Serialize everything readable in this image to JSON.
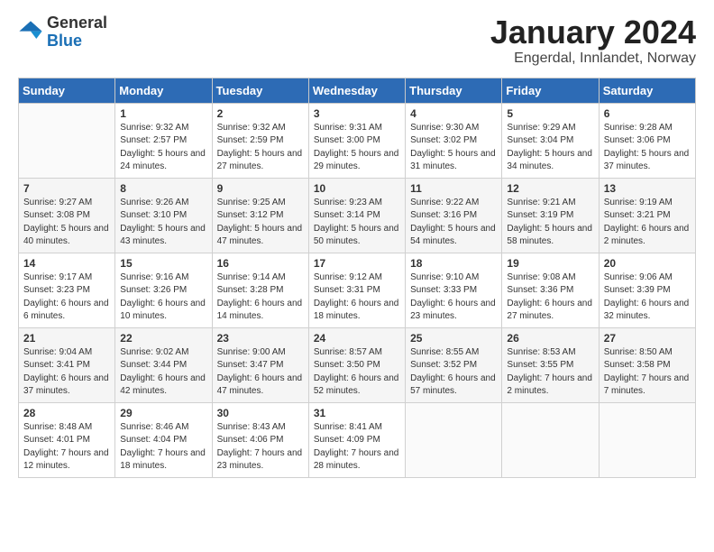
{
  "header": {
    "logo_general": "General",
    "logo_blue": "Blue",
    "month_title": "January 2024",
    "location": "Engerdal, Innlandet, Norway"
  },
  "weekdays": [
    "Sunday",
    "Monday",
    "Tuesday",
    "Wednesday",
    "Thursday",
    "Friday",
    "Saturday"
  ],
  "weeks": [
    [
      {
        "day": "",
        "sunrise": "",
        "sunset": "",
        "daylight": ""
      },
      {
        "day": "1",
        "sunrise": "9:32 AM",
        "sunset": "2:57 PM",
        "daylight": "5 hours and 24 minutes."
      },
      {
        "day": "2",
        "sunrise": "9:32 AM",
        "sunset": "2:59 PM",
        "daylight": "5 hours and 27 minutes."
      },
      {
        "day": "3",
        "sunrise": "9:31 AM",
        "sunset": "3:00 PM",
        "daylight": "5 hours and 29 minutes."
      },
      {
        "day": "4",
        "sunrise": "9:30 AM",
        "sunset": "3:02 PM",
        "daylight": "5 hours and 31 minutes."
      },
      {
        "day": "5",
        "sunrise": "9:29 AM",
        "sunset": "3:04 PM",
        "daylight": "5 hours and 34 minutes."
      },
      {
        "day": "6",
        "sunrise": "9:28 AM",
        "sunset": "3:06 PM",
        "daylight": "5 hours and 37 minutes."
      }
    ],
    [
      {
        "day": "7",
        "sunrise": "9:27 AM",
        "sunset": "3:08 PM",
        "daylight": "5 hours and 40 minutes."
      },
      {
        "day": "8",
        "sunrise": "9:26 AM",
        "sunset": "3:10 PM",
        "daylight": "5 hours and 43 minutes."
      },
      {
        "day": "9",
        "sunrise": "9:25 AM",
        "sunset": "3:12 PM",
        "daylight": "5 hours and 47 minutes."
      },
      {
        "day": "10",
        "sunrise": "9:23 AM",
        "sunset": "3:14 PM",
        "daylight": "5 hours and 50 minutes."
      },
      {
        "day": "11",
        "sunrise": "9:22 AM",
        "sunset": "3:16 PM",
        "daylight": "5 hours and 54 minutes."
      },
      {
        "day": "12",
        "sunrise": "9:21 AM",
        "sunset": "3:19 PM",
        "daylight": "5 hours and 58 minutes."
      },
      {
        "day": "13",
        "sunrise": "9:19 AM",
        "sunset": "3:21 PM",
        "daylight": "6 hours and 2 minutes."
      }
    ],
    [
      {
        "day": "14",
        "sunrise": "9:17 AM",
        "sunset": "3:23 PM",
        "daylight": "6 hours and 6 minutes."
      },
      {
        "day": "15",
        "sunrise": "9:16 AM",
        "sunset": "3:26 PM",
        "daylight": "6 hours and 10 minutes."
      },
      {
        "day": "16",
        "sunrise": "9:14 AM",
        "sunset": "3:28 PM",
        "daylight": "6 hours and 14 minutes."
      },
      {
        "day": "17",
        "sunrise": "9:12 AM",
        "sunset": "3:31 PM",
        "daylight": "6 hours and 18 minutes."
      },
      {
        "day": "18",
        "sunrise": "9:10 AM",
        "sunset": "3:33 PM",
        "daylight": "6 hours and 23 minutes."
      },
      {
        "day": "19",
        "sunrise": "9:08 AM",
        "sunset": "3:36 PM",
        "daylight": "6 hours and 27 minutes."
      },
      {
        "day": "20",
        "sunrise": "9:06 AM",
        "sunset": "3:39 PM",
        "daylight": "6 hours and 32 minutes."
      }
    ],
    [
      {
        "day": "21",
        "sunrise": "9:04 AM",
        "sunset": "3:41 PM",
        "daylight": "6 hours and 37 minutes."
      },
      {
        "day": "22",
        "sunrise": "9:02 AM",
        "sunset": "3:44 PM",
        "daylight": "6 hours and 42 minutes."
      },
      {
        "day": "23",
        "sunrise": "9:00 AM",
        "sunset": "3:47 PM",
        "daylight": "6 hours and 47 minutes."
      },
      {
        "day": "24",
        "sunrise": "8:57 AM",
        "sunset": "3:50 PM",
        "daylight": "6 hours and 52 minutes."
      },
      {
        "day": "25",
        "sunrise": "8:55 AM",
        "sunset": "3:52 PM",
        "daylight": "6 hours and 57 minutes."
      },
      {
        "day": "26",
        "sunrise": "8:53 AM",
        "sunset": "3:55 PM",
        "daylight": "7 hours and 2 minutes."
      },
      {
        "day": "27",
        "sunrise": "8:50 AM",
        "sunset": "3:58 PM",
        "daylight": "7 hours and 7 minutes."
      }
    ],
    [
      {
        "day": "28",
        "sunrise": "8:48 AM",
        "sunset": "4:01 PM",
        "daylight": "7 hours and 12 minutes."
      },
      {
        "day": "29",
        "sunrise": "8:46 AM",
        "sunset": "4:04 PM",
        "daylight": "7 hours and 18 minutes."
      },
      {
        "day": "30",
        "sunrise": "8:43 AM",
        "sunset": "4:06 PM",
        "daylight": "7 hours and 23 minutes."
      },
      {
        "day": "31",
        "sunrise": "8:41 AM",
        "sunset": "4:09 PM",
        "daylight": "7 hours and 28 minutes."
      },
      {
        "day": "",
        "sunrise": "",
        "sunset": "",
        "daylight": ""
      },
      {
        "day": "",
        "sunrise": "",
        "sunset": "",
        "daylight": ""
      },
      {
        "day": "",
        "sunrise": "",
        "sunset": "",
        "daylight": ""
      }
    ]
  ]
}
